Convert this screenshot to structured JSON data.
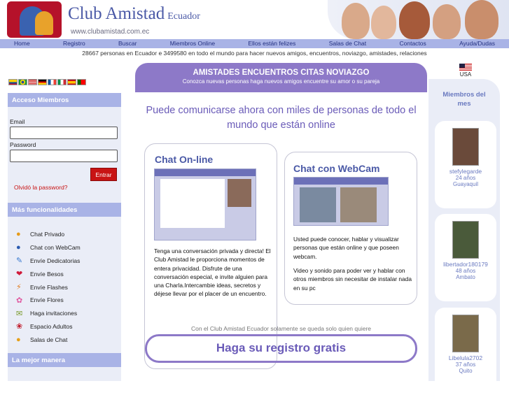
{
  "header": {
    "title": "Club Amistad",
    "subtitle": "Ecuador",
    "url": "www.clubamistad.com.ec"
  },
  "nav": [
    "Home",
    "Registro",
    "Buscar",
    "Miembros Online",
    "Ellos están felizes",
    "Salas de Chat",
    "Contactos",
    "Ayuda/Dudas"
  ],
  "counter_text": "28667 personas en Ecuador e 3499580 en todo el mundo para hacer nuevos amigos, encuentros, noviazgo, amistades, relaciones",
  "usa_label": "USA",
  "login": {
    "heading": "Acceso Miembros",
    "email_label": "Email",
    "password_label": "Password",
    "submit": "Entrar",
    "forgot": "Olvidó la password?"
  },
  "functions": {
    "heading": "Más funcionalidades",
    "items": [
      {
        "label": "Chat Privado",
        "icon": "chat-icon"
      },
      {
        "label": "Chat con WebCam",
        "icon": "webcam-icon"
      },
      {
        "label": "Envíe Dedicatorias",
        "icon": "dedication-icon"
      },
      {
        "label": "Envíe Besos",
        "icon": "kiss-icon"
      },
      {
        "label": "Envíe Flashes",
        "icon": "flash-icon"
      },
      {
        "label": "Envíe Flores",
        "icon": "flower-icon"
      },
      {
        "label": "Haga invitaciones",
        "icon": "invitation-icon"
      },
      {
        "label": "Espacio Adultos",
        "icon": "adult-icon"
      },
      {
        "label": "Salas de Chat",
        "icon": "chatroom-icon"
      }
    ]
  },
  "better": {
    "heading": "La mejor manera"
  },
  "banner": {
    "title": "AMISTADES ENCUENTROS CITAS NOVIAZGO",
    "subtitle": "Conozca nuevas personas haga nuevos amigos encuentre su amor o su pareja"
  },
  "lead": "Puede comunicarse ahora con miles de personas de todo el mundo que están online",
  "chat_box": {
    "title": "Chat On-line",
    "text": "Tenga una conversación privada y directa! El Club Amistad le proporciona momentos de entera privacidad. Disfrute de una conversación especial, e invite alguien para una Charla.Intercambie ideas, secretos y déjese llevar por el placer de un encuentro."
  },
  "webcam_box": {
    "title": "Chat con WebCam",
    "text1": "Usted puede conocer, hablar y visualizar personas que están online y que poseen webcam.",
    "text2": "Video y sonido para poder ver y hablar con otros miembros sin necesitar de instalar nada en su pc"
  },
  "tagline": "Con el Club Amistad Ecuador solamente se queda solo quien quiere",
  "register": "Haga su registro gratis",
  "members": {
    "heading": "Miembros del mes",
    "list": [
      {
        "name": "stefylegarde",
        "age": "24 años",
        "city": "Guayaquil"
      },
      {
        "name": "libertador180179",
        "age": "48 años",
        "city": "Ambato"
      },
      {
        "name": "Libelula2702",
        "age": "37 años",
        "city": "Quito"
      }
    ]
  }
}
